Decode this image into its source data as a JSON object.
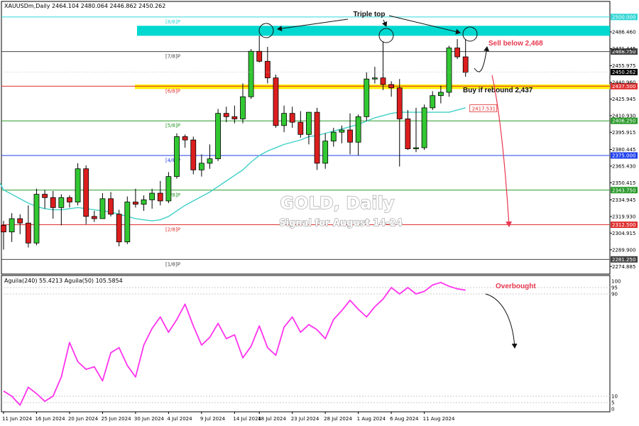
{
  "header": {
    "symbol_line": "XAUUSDm,Daily  2464.104 2480.064 2446.862 2450.262",
    "indicator_line": "Aguila(240) 55.4213  Aguila(50) 105.5854"
  },
  "watermark": {
    "title": "GOLD, Daily",
    "subtitle": "Signal for August 14-24"
  },
  "annotations": {
    "triple_top": "Triple top",
    "sell": "Sell below 2,468",
    "buy": "Buy if rebound 2,437",
    "overbought": "Overbought"
  },
  "colors": {
    "bull": "#32c832",
    "bear": "#dc1e1e",
    "ma": "#40d0c8",
    "oscillator": "#ff33ee",
    "cyan_zone": "#00d8d0",
    "yellow_zone": "#ffee00",
    "arrow_red": "#e8384f"
  },
  "chart_data": {
    "type": "candlestick",
    "ylim": [
      2268,
      2514
    ],
    "price_ticks": [
      "2486.460",
      "2471.445",
      "2455.975",
      "2440.960",
      "2425.945",
      "2410.930",
      "2395.915",
      "2380.445",
      "2365.430",
      "2350.415",
      "2334.945",
      "2319.930",
      "2304.915",
      "2289.900",
      "2274.885"
    ],
    "date_labels": [
      {
        "label": "11 Jun 2024",
        "index": 0
      },
      {
        "label": "16 Jun 2024",
        "index": 4
      },
      {
        "label": "20 Jun 2024",
        "index": 8
      },
      {
        "label": "25 Jun 2024",
        "index": 12
      },
      {
        "label": "30 Jun 2024",
        "index": 16
      },
      {
        "label": "4 Jul 2024",
        "index": 20
      },
      {
        "label": "9 Jul 2024",
        "index": 24
      },
      {
        "label": "14 Jul 2024",
        "index": 28
      },
      {
        "label": "18 Jul 2024",
        "index": 31
      },
      {
        "label": "23 Jul 2024",
        "index": 35
      },
      {
        "label": "28 Jul 2024",
        "index": 39
      },
      {
        "label": "1 Aug 2024",
        "index": 43
      },
      {
        "label": "6 Aug 2024",
        "index": 47
      },
      {
        "label": "11 Aug 2024",
        "index": 51
      }
    ],
    "candles": [
      [
        2312,
        2316,
        2290,
        2306
      ],
      [
        2306,
        2323,
        2297,
        2318
      ],
      [
        2318,
        2322,
        2304,
        2314
      ],
      [
        2314,
        2330,
        2292,
        2296
      ],
      [
        2296,
        2345,
        2294,
        2340
      ],
      [
        2340,
        2344,
        2327,
        2337
      ],
      [
        2337,
        2343,
        2318,
        2328
      ],
      [
        2328,
        2340,
        2312,
        2337
      ],
      [
        2337,
        2339,
        2328,
        2333
      ],
      [
        2333,
        2368,
        2330,
        2363
      ],
      [
        2363,
        2366,
        2313,
        2320
      ],
      [
        2320,
        2325,
        2315,
        2318
      ],
      [
        2318,
        2341,
        2318,
        2336
      ],
      [
        2336,
        2342,
        2320,
        2322
      ],
      [
        2322,
        2326,
        2293,
        2297
      ],
      [
        2297,
        2338,
        2295,
        2333
      ],
      [
        2333,
        2345,
        2328,
        2331
      ],
      [
        2331,
        2339,
        2325,
        2335
      ],
      [
        2335,
        2345,
        2327,
        2341
      ],
      [
        2341,
        2352,
        2330,
        2334
      ],
      [
        2334,
        2360,
        2332,
        2356
      ],
      [
        2356,
        2395,
        2354,
        2392
      ],
      [
        2392,
        2394,
        2382,
        2389
      ],
      [
        2389,
        2392,
        2358,
        2362
      ],
      [
        2362,
        2376,
        2356,
        2368
      ],
      [
        2368,
        2385,
        2363,
        2372
      ],
      [
        2372,
        2417,
        2370,
        2413
      ],
      [
        2413,
        2419,
        2405,
        2410
      ],
      [
        2410,
        2420,
        2404,
        2408
      ],
      [
        2408,
        2440,
        2404,
        2428
      ],
      [
        2428,
        2471,
        2426,
        2469
      ],
      [
        2469,
        2483,
        2459,
        2460
      ],
      [
        2460,
        2473,
        2440,
        2445
      ],
      [
        2445,
        2448,
        2400,
        2402
      ],
      [
        2402,
        2420,
        2396,
        2413
      ],
      [
        2413,
        2419,
        2400,
        2405
      ],
      [
        2405,
        2415,
        2391,
        2394
      ],
      [
        2394,
        2410,
        2385,
        2414
      ],
      [
        2414,
        2418,
        2362,
        2368
      ],
      [
        2368,
        2395,
        2363,
        2388
      ],
      [
        2388,
        2400,
        2383,
        2396
      ],
      [
        2396,
        2402,
        2386,
        2398
      ],
      [
        2398,
        2413,
        2376,
        2387
      ],
      [
        2387,
        2412,
        2375,
        2410
      ],
      [
        2410,
        2450,
        2406,
        2444
      ],
      [
        2444,
        2455,
        2440,
        2445
      ],
      [
        2445,
        2478,
        2434,
        2439
      ],
      [
        2439,
        2442,
        2428,
        2436
      ],
      [
        2436,
        2444,
        2365,
        2408
      ],
      [
        2408,
        2416,
        2380,
        2381
      ],
      [
        2381,
        2418,
        2378,
        2382
      ],
      [
        2382,
        2421,
        2380,
        2418
      ],
      [
        2418,
        2433,
        2416,
        2429
      ],
      [
        2429,
        2438,
        2422,
        2432
      ],
      [
        2432,
        2474,
        2428,
        2472
      ],
      [
        2472,
        2480,
        2462,
        2464
      ],
      [
        2464,
        2480,
        2446,
        2450
      ]
    ],
    "moving_average": {
      "name": "",
      "values": [
        2344,
        2340,
        2336,
        2332,
        2329,
        2327,
        2326,
        2326,
        2327,
        2328,
        2327,
        2326,
        2325,
        2324,
        2322,
        2320,
        2318,
        2317,
        2316,
        2317,
        2320,
        2325,
        2330,
        2334,
        2338,
        2342,
        2347,
        2352,
        2357,
        2362,
        2369,
        2375,
        2379,
        2382,
        2385,
        2387,
        2389,
        2392,
        2393,
        2395,
        2397,
        2399,
        2401,
        2403,
        2406,
        2409,
        2411,
        2413,
        2414,
        2414,
        2414,
        2414,
        2414,
        2414,
        2414,
        2416,
        2418
      ]
    },
    "murrey_levels": [
      {
        "label": "[8/8]P",
        "price": 2500.0,
        "value_label": "2500.000",
        "color": "#33d6d6"
      },
      {
        "label": "[7/8]P",
        "price": 2468.75,
        "value_label": "2468.750",
        "color": "#444444"
      },
      {
        "label": "[6/8]P",
        "price": 2437.5,
        "value_label": "2437.500",
        "color": "#e03030"
      },
      {
        "label": "[5/8]P",
        "price": 2406.25,
        "value_label": "2406.250",
        "color": "#2a9a2a"
      },
      {
        "label": "[4/8]P",
        "price": 2375.0,
        "value_label": "2375.000",
        "color": "#2040ee"
      },
      {
        "label": "[3/8]P",
        "price": 2343.75,
        "value_label": "2343.750",
        "color": "#2a9a2a"
      },
      {
        "label": "[2/8]P",
        "price": 2312.5,
        "value_label": "2312.500",
        "color": "#e03030"
      },
      {
        "label": "[1/8]P",
        "price": 2281.25,
        "value_label": "2281.250",
        "color": "#444444"
      }
    ],
    "current_price": {
      "price": 2450.262,
      "label": "2450.262"
    },
    "ma_value": {
      "price": 2417.531,
      "label": "2417.531"
    },
    "zones": [
      {
        "name": "resistance",
        "from": 2483,
        "to": 2492
      },
      {
        "name": "support",
        "from": 2435,
        "to": 2439
      }
    ],
    "oscillator": {
      "ylim": [
        0,
        100
      ],
      "ticks": [
        "100",
        "95",
        "90",
        "10",
        "5",
        "0"
      ],
      "levels": [
        95,
        90,
        10,
        5
      ],
      "values": [
        14,
        10,
        3,
        17,
        12,
        6,
        10,
        25,
        52,
        37,
        31,
        33,
        22,
        44,
        48,
        34,
        25,
        50,
        63,
        72,
        60,
        70,
        82,
        65,
        50,
        56,
        67,
        55,
        58,
        40,
        49,
        65,
        48,
        42,
        64,
        72,
        60,
        66,
        62,
        55,
        70,
        77,
        85,
        78,
        72,
        80,
        86,
        95,
        90,
        95,
        90,
        92,
        97,
        99,
        96,
        94,
        93
      ]
    }
  }
}
